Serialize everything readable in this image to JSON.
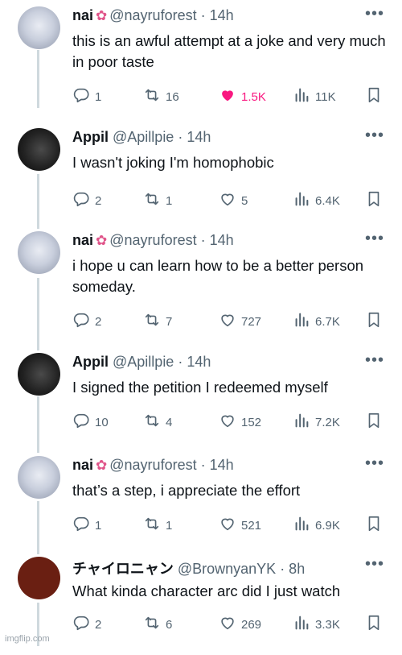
{
  "colors": {
    "like_active": "#f91880",
    "muted": "#536471",
    "thread_line": "#cfd9de"
  },
  "tweets": [
    {
      "name": "nai",
      "emoji": "hibiscus-emoji",
      "handle": "@nayruforest",
      "time": "· 14h",
      "text": "this is an awful attempt at a joke and very much in poor taste",
      "replies": "1",
      "retweets": "16",
      "likes": "1.5K",
      "views": "11K",
      "liked": true,
      "avatar": "nai"
    },
    {
      "name": "Appil",
      "emoji": "",
      "handle": "@Apillpie",
      "time": "· 14h",
      "text": "I wasn't joking I'm homophobic",
      "replies": "2",
      "retweets": "1",
      "likes": "5",
      "views": "6.4K",
      "liked": false,
      "avatar": "appil"
    },
    {
      "name": "nai",
      "emoji": "hibiscus-emoji",
      "handle": "@nayruforest",
      "time": "· 14h",
      "text": "i hope u can learn how to be a better person someday.",
      "replies": "2",
      "retweets": "7",
      "likes": "727",
      "views": "6.7K",
      "liked": false,
      "avatar": "nai"
    },
    {
      "name": "Appil",
      "emoji": "",
      "handle": "@Apillpie",
      "time": "· 14h",
      "text": "I signed the petition I redeemed myself",
      "replies": "10",
      "retweets": "4",
      "likes": "152",
      "views": "7.2K",
      "liked": false,
      "avatar": "appil"
    },
    {
      "name": "nai",
      "emoji": "hibiscus-emoji",
      "handle": "@nayruforest",
      "time": "· 14h",
      "text": "that’s a step, i appreciate the effort",
      "replies": "1",
      "retweets": "1",
      "likes": "521",
      "views": "6.9K",
      "liked": false,
      "avatar": "nai"
    },
    {
      "name": "チャイロニャン",
      "emoji": "",
      "handle": "@BrownyanYK",
      "time": "· 8h",
      "text": "What kinda character arc did I just watch",
      "replies": "2",
      "retweets": "6",
      "likes": "269",
      "views": "3.3K",
      "liked": false,
      "avatar": "brown"
    }
  ],
  "watermark": "imgflip.com"
}
